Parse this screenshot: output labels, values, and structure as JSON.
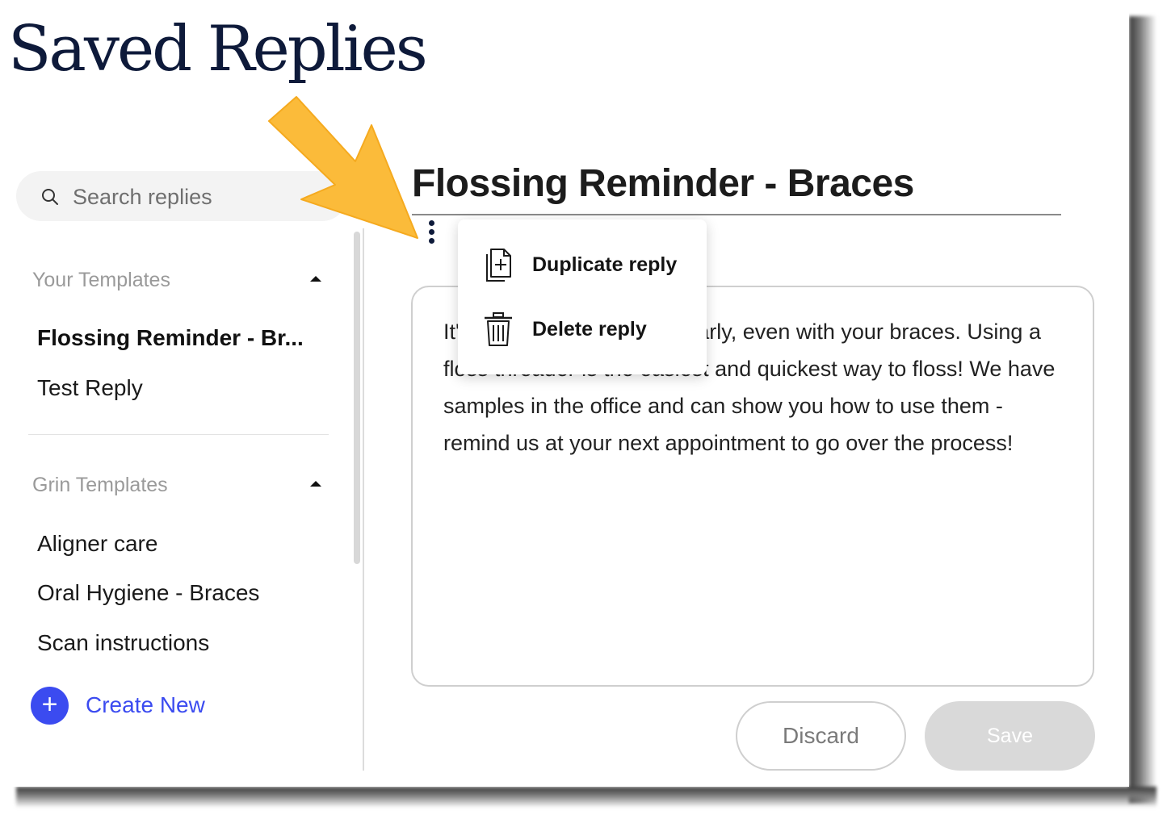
{
  "brand": {
    "title": "Saved Replies"
  },
  "search": {
    "placeholder": "Search replies",
    "value": ""
  },
  "sidebar": {
    "your_templates": {
      "label": "Your Templates",
      "items": [
        {
          "label": "Flossing Reminder - Br...",
          "active": true
        },
        {
          "label": "Test Reply",
          "active": false
        }
      ]
    },
    "grin_templates": {
      "label": "Grin Templates",
      "items": [
        {
          "label": "Aligner care"
        },
        {
          "label": "Oral Hygiene - Braces"
        },
        {
          "label": "Scan instructions"
        }
      ]
    },
    "create_new": "Create New"
  },
  "reply": {
    "title": "Flossing Reminder - Braces",
    "body": "It's important to floss regularly, even with your braces. Using a floss threader is the easiest and quickest way to floss! We have samples in the office and can show you how to use them - remind us at your next appointment to go over the process!"
  },
  "menu": {
    "duplicate_label": "Duplicate reply",
    "delete_label": "Delete reply"
  },
  "actions": {
    "discard_label": "Discard",
    "save_label": "Save"
  },
  "colors": {
    "accent": "#3b4bf0",
    "brand_text": "#0e1a3a",
    "arrow": "#fbbb3a"
  }
}
